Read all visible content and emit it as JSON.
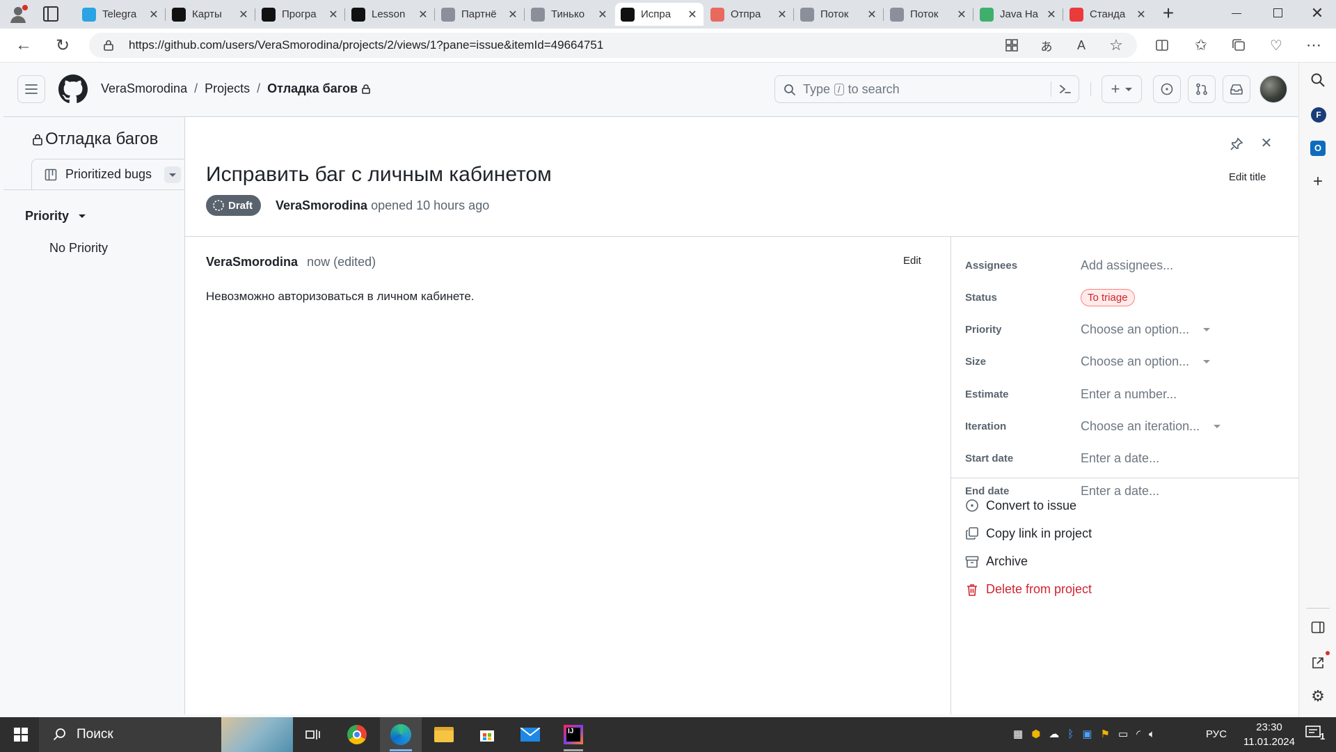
{
  "browser": {
    "tabs": [
      {
        "title": "Telegra",
        "icon": "telegram-icon",
        "color": "#2aa4e4"
      },
      {
        "title": "Карты",
        "icon": "notion-icon",
        "color": "#111111"
      },
      {
        "title": "Програ",
        "icon": "lambda-icon",
        "color": "#111111"
      },
      {
        "title": "Lesson",
        "icon": "github-icon",
        "color": "#111111"
      },
      {
        "title": "Партнё",
        "icon": "shield-icon",
        "color": "#8a8f99"
      },
      {
        "title": "Тинько",
        "icon": "shield-icon",
        "color": "#8a8f99"
      },
      {
        "title": "Испра",
        "icon": "github-icon",
        "color": "#111111",
        "active": true
      },
      {
        "title": "Отпра",
        "icon": "mail-icon",
        "color": "#e86a5e"
      },
      {
        "title": "Поток",
        "icon": "flow-icon",
        "color": "#8a8f99"
      },
      {
        "title": "Поток",
        "icon": "flow-icon",
        "color": "#8a8f99"
      },
      {
        "title": "Java Ha",
        "icon": "w-icon",
        "color": "#3fb06b"
      },
      {
        "title": "Станда",
        "icon": "youtube-icon",
        "color": "#ea3b3b"
      }
    ],
    "url": "https://github.com/users/VeraSmorodina/projects/2/views/1?pane=issue&itemId=49664751"
  },
  "header": {
    "owner": "VeraSmorodina",
    "sep1": "/",
    "projects": "Projects",
    "sep2": "/",
    "project": "Отладка багов",
    "search_pre": "Type",
    "search_key": "/",
    "search_post": "to search"
  },
  "left": {
    "project_title": "Отладка багов",
    "view_tab": "Prioritized bugs",
    "group_label": "Priority",
    "group_value": "No Priority"
  },
  "issue": {
    "title": "Исправить баг с личным кабинетом",
    "state": "Draft",
    "author": "VeraSmorodina",
    "opened": "opened 10 hours ago",
    "edit_title": "Edit title",
    "comment_author": "VeraSmorodina",
    "comment_time": "now (edited)",
    "comment_edit": "Edit",
    "comment_body": "Невозможно авторизоваться в личном кабинете."
  },
  "fields": [
    {
      "label": "Assignees",
      "value": "Add assignees...",
      "caret": false
    },
    {
      "label": "Status",
      "value": "To triage",
      "badge": true
    },
    {
      "label": "Priority",
      "value": "Choose an option...",
      "caret": true
    },
    {
      "label": "Size",
      "value": "Choose an option...",
      "caret": true
    },
    {
      "label": "Estimate",
      "value": "Enter a number...",
      "caret": false
    },
    {
      "label": "Iteration",
      "value": "Choose an iteration...",
      "caret": true
    },
    {
      "label": "Start date",
      "value": "Enter a date...",
      "caret": false
    },
    {
      "label": "End date",
      "value": "Enter a date...",
      "caret": false
    }
  ],
  "actions": [
    {
      "label": "Convert to issue",
      "icon": "issue-opened-icon",
      "danger": false
    },
    {
      "label": "Copy link in project",
      "icon": "copy-icon",
      "danger": false
    },
    {
      "label": "Archive",
      "icon": "archive-icon",
      "danger": false
    },
    {
      "label": "Delete from project",
      "icon": "trash-icon",
      "danger": true
    }
  ],
  "taskbar": {
    "search": "Поиск",
    "lang": "РУС",
    "time": "23:30",
    "date": "11.01.2024",
    "notifications": "1"
  },
  "colors": {
    "danger": "#d1242f",
    "status_badge_bg": "#ffebe9",
    "status_badge_border": "#ff8182",
    "draft_bg": "#59636e"
  }
}
